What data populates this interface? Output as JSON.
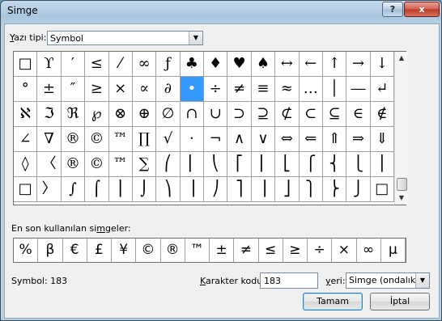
{
  "window": {
    "title": "Simge",
    "help_label": "?",
    "close_label": "x"
  },
  "font": {
    "label_pre": "",
    "label_u": "Y",
    "label_post": "azı tipi:",
    "value": "Symbol"
  },
  "grid": {
    "rows": [
      [
        "□",
        "ϒ",
        "′",
        "≤",
        "⁄",
        "∞",
        "ƒ",
        "♣",
        "♦",
        "♥",
        "♠",
        "↔",
        "←",
        "↑",
        "→",
        "↓"
      ],
      [
        "°",
        "±",
        "″",
        "≥",
        "×",
        "∝",
        "∂",
        "•",
        "÷",
        "≠",
        "≡",
        "≈",
        "…",
        "│",
        "―",
        "↵"
      ],
      [
        "ℵ",
        "ℑ",
        "ℜ",
        "℘",
        "⊗",
        "⊕",
        "∅",
        "∩",
        "∪",
        "⊃",
        "⊇",
        "⊄",
        "⊂",
        "⊆",
        "∈",
        "∉"
      ],
      [
        "∠",
        "∇",
        "®",
        "©",
        "™",
        "∏",
        "√",
        "⋅",
        "¬",
        "∧",
        "∨",
        "⇔",
        "⇐",
        "⇑",
        "⇒",
        "⇓"
      ],
      [
        "◊",
        "〈",
        "®",
        "©",
        "™",
        "∑",
        "⎛",
        "⎜",
        "⎝",
        "⎡",
        "⎢",
        "⎣",
        "⎧",
        "⎨",
        "⎩",
        "⎪"
      ],
      [
        "□",
        "〉",
        "∫",
        "⌠",
        "⎮",
        "⌡",
        "⎞",
        "⎟",
        "⎠",
        "⎤",
        "⎥",
        "⎦",
        "⎫",
        "⎬",
        "⎭",
        "□"
      ]
    ],
    "selected": {
      "row": 1,
      "col": 7
    }
  },
  "recent": {
    "label_pre": "En son kullanılan si",
    "label_u": "m",
    "label_post": "geler:",
    "symbols": [
      "%",
      "β",
      "€",
      "£",
      "¥",
      "©",
      "®",
      "™",
      "±",
      "≠",
      "≤",
      "≥",
      "÷",
      "×",
      "∞",
      "µ"
    ]
  },
  "status": {
    "symbol_text": "Symbol: 183"
  },
  "charcode": {
    "label_pre": "",
    "label_u": "K",
    "label_post": "arakter kodu:",
    "value": "183"
  },
  "from": {
    "label_pre": "",
    "label_u": "y",
    "label_post": "eri:",
    "value": "Simge (ondalık)"
  },
  "buttons": {
    "ok": "Tamam",
    "cancel": "İptal"
  }
}
